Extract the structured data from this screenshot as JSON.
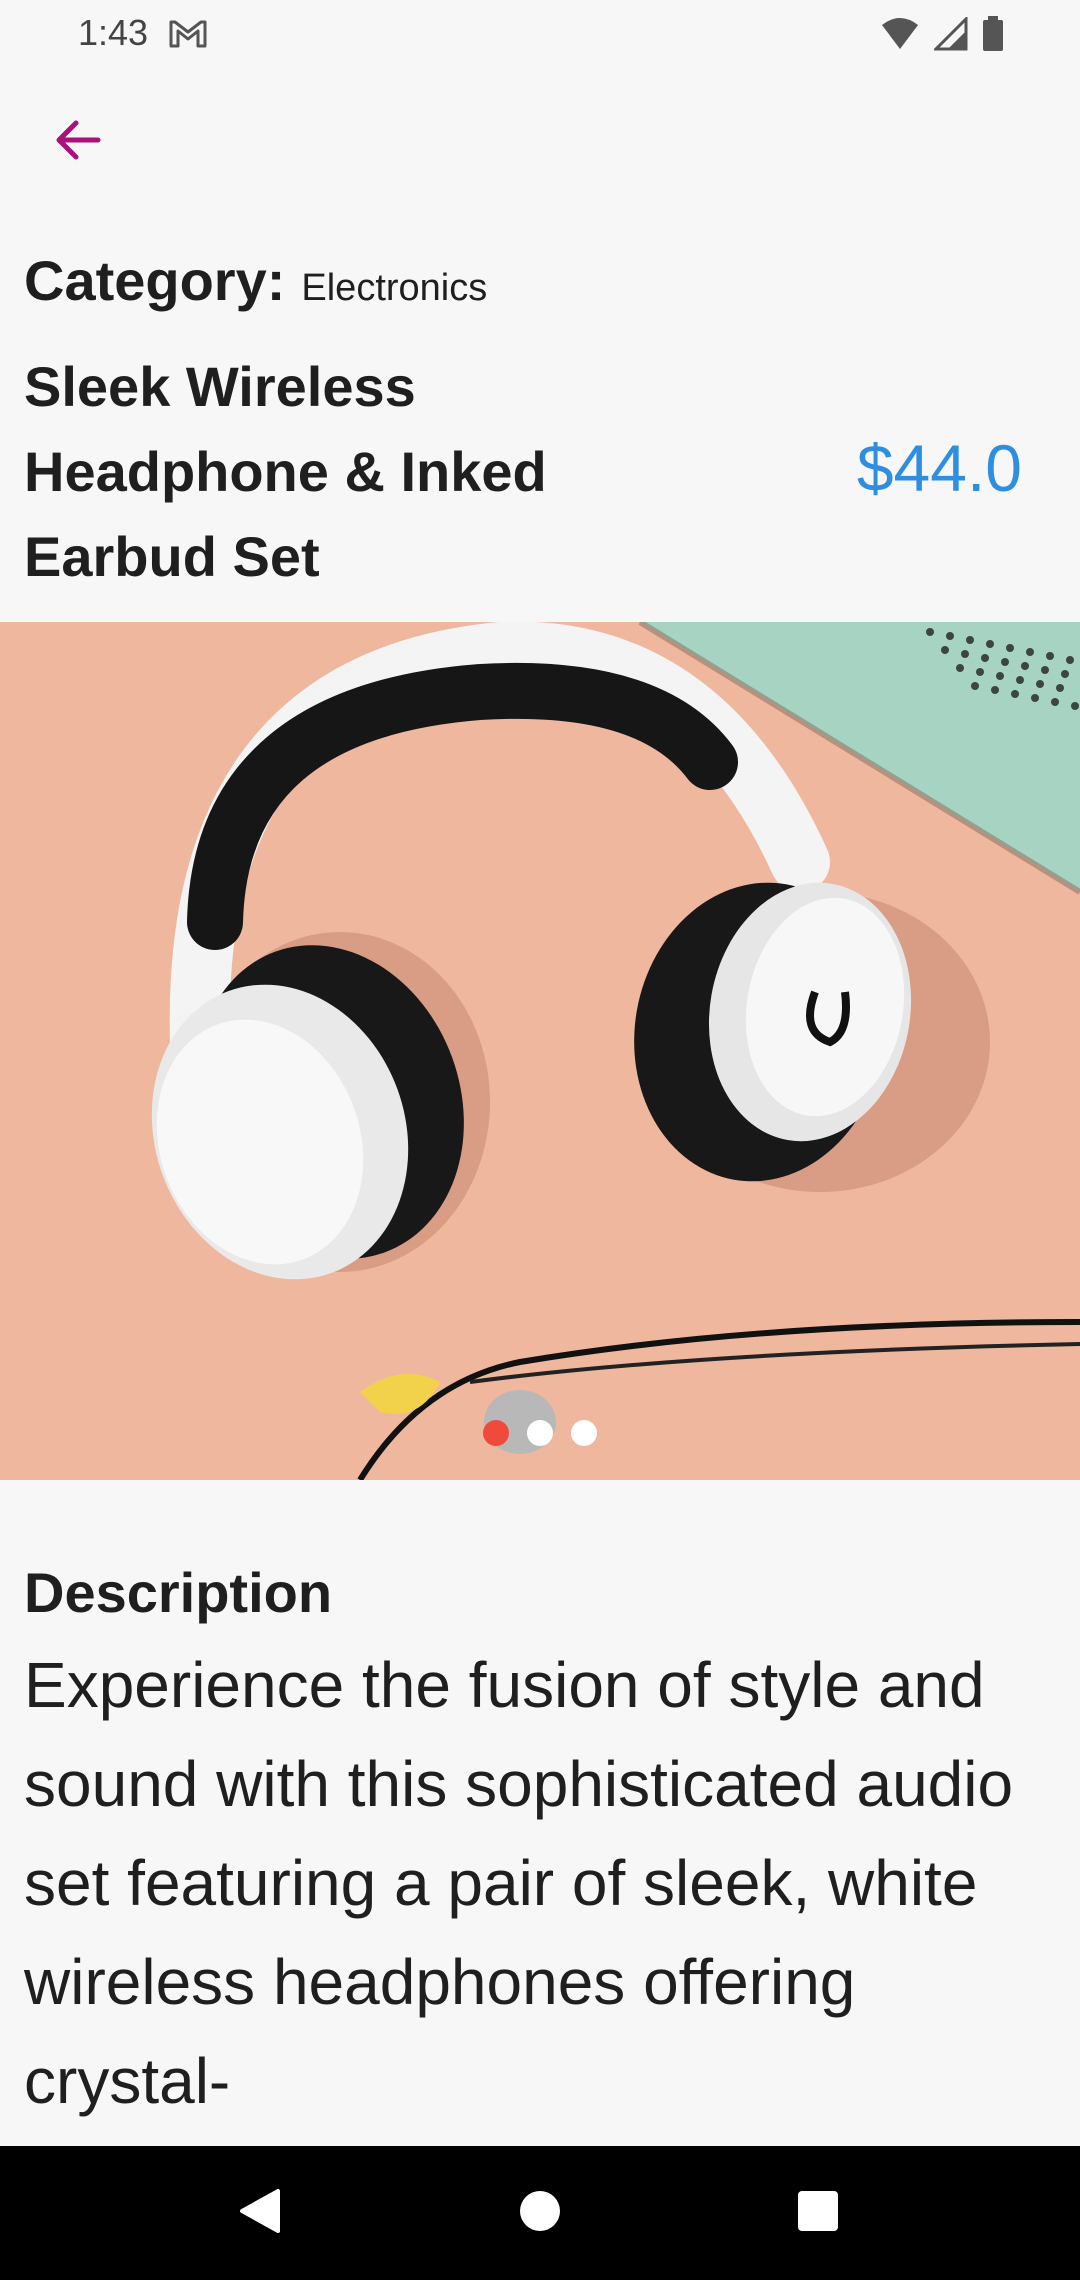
{
  "status_bar": {
    "time": "1:43",
    "icons": [
      "gmail-icon",
      "wifi-icon",
      "signal-icon",
      "battery-icon"
    ]
  },
  "header": {
    "back_icon": "arrow-left-icon",
    "back_color": "#a8127a"
  },
  "product": {
    "category_label": "Category:",
    "category_value": "Electronics",
    "title": "Sleek Wireless Headphone & Inked Earbud Set",
    "price": "$44.0",
    "price_color": "#2e8fe0"
  },
  "carousel": {
    "image_subject": "white-and-black-headphones-with-earbuds",
    "dot_count": 3,
    "active_index": 0,
    "active_color": "#f04a3a"
  },
  "description": {
    "heading": "Description",
    "text": "Experience the fusion of style and sound with this sophisticated audio set featuring a pair of sleek, white wireless headphones offering crystal-"
  },
  "nav_bar": {
    "icons": [
      "back-triangle-icon",
      "home-circle-icon",
      "recents-square-icon"
    ]
  }
}
